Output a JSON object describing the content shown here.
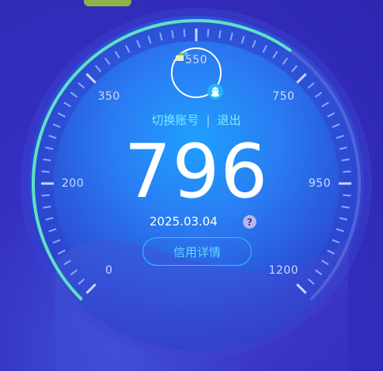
{
  "gauge": {
    "min_label": "0",
    "labels": [
      "0",
      "200",
      "350",
      "550",
      "750",
      "950",
      "1200"
    ],
    "score": "796",
    "date": "2025.03.04",
    "progress_fraction": 0.63,
    "colors": {
      "accent_arc": "#5fe0c5",
      "dial_inner": "#2f7df5",
      "dial_outer": "#2454e0",
      "background": "#3530c2"
    }
  },
  "account": {
    "switch_label": "切换账号",
    "separator": "|",
    "logout_label": "退出"
  },
  "help": {
    "symbol": "?"
  },
  "detail_button": {
    "label": "信用详情"
  },
  "icons": {
    "avatar": "avatar-icon",
    "qq": "qq-penguin-icon",
    "help": "question-icon"
  }
}
